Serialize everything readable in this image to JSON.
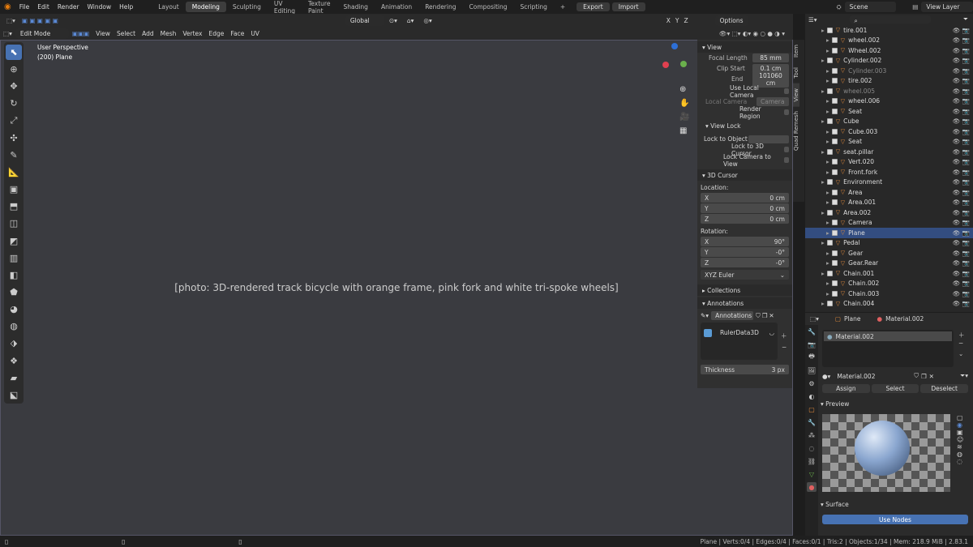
{
  "menu": [
    "File",
    "Edit",
    "Render",
    "Window",
    "Help"
  ],
  "workspaces": [
    "Layout",
    "Modeling",
    "Sculpting",
    "UV Editing",
    "Texture Paint",
    "Shading",
    "Animation",
    "Rendering",
    "Compositing",
    "Scripting"
  ],
  "active_workspace": "Modeling",
  "plus": "+",
  "export_label": "Export",
  "import_label": "Import",
  "scene": "Scene",
  "view_layer": "View Layer",
  "header": {
    "transform": "Global",
    "options": "Options",
    "xyz": [
      "X",
      "Y",
      "Z"
    ]
  },
  "header2": {
    "mode": "Edit Mode",
    "menus": [
      "View",
      "Select",
      "Add",
      "Mesh",
      "Vertex",
      "Edge",
      "Face",
      "UV"
    ]
  },
  "viewport": {
    "line1": "User Perspective",
    "line2": "(200) Plane",
    "photo_label": "[photo: 3D-rendered track bicycle with orange frame, pink fork and white tri-spoke wheels]"
  },
  "npanel": {
    "view_title": "View",
    "focal_length_label": "Focal Length",
    "focal_length": "85 mm",
    "clip_start_label": "Clip Start",
    "clip_start": "0.1 cm",
    "end_label": "End",
    "end": "101060 cm",
    "use_local_camera": "Use Local Camera",
    "local_camera_label": "Local Camera",
    "local_camera": "Camera",
    "render_region": "Render Region",
    "view_lock_title": "View Lock",
    "lock_to_object": "Lock to Object",
    "lock_3d_cursor": "Lock to 3D Cursor",
    "lock_camera_to_view": "Lock Camera to View",
    "cursor_title": "3D Cursor",
    "location_label": "Location:",
    "loc": [
      {
        "axis": "X",
        "value": "0 cm"
      },
      {
        "axis": "Y",
        "value": "0 cm"
      },
      {
        "axis": "Z",
        "value": "0 cm"
      }
    ],
    "rotation_label": "Rotation:",
    "rot": [
      {
        "axis": "X",
        "value": "90°"
      },
      {
        "axis": "Y",
        "value": "-0°"
      },
      {
        "axis": "Z",
        "value": "-0°"
      }
    ],
    "rot_mode": "XYZ Euler",
    "collections": "Collections",
    "annotations_title": "Annotations",
    "annotations_field": "Annotations",
    "ruler": "RulerData3D",
    "thickness_label": "Thickness",
    "thickness": "3 px"
  },
  "ntabs": [
    "Item",
    "Tool",
    "View",
    "Quad Remesh"
  ],
  "outliner": [
    {
      "name": "tire.001",
      "dim": false,
      "sel": false
    },
    {
      "name": "wheel.002",
      "dim": false,
      "sel": false
    },
    {
      "name": "Wheel.002",
      "dim": false,
      "sel": false
    },
    {
      "name": "Cylinder.002",
      "dim": false,
      "sel": false
    },
    {
      "name": "Cylinder.003",
      "dim": true,
      "sel": false
    },
    {
      "name": "tire.002",
      "dim": false,
      "sel": false
    },
    {
      "name": "wheel.005",
      "dim": true,
      "sel": false
    },
    {
      "name": "wheel.006",
      "dim": false,
      "sel": false
    },
    {
      "name": "Seat",
      "dim": false,
      "sel": false
    },
    {
      "name": "Cube",
      "dim": false,
      "sel": false
    },
    {
      "name": "Cube.003",
      "dim": false,
      "sel": false
    },
    {
      "name": "Seat",
      "dim": false,
      "sel": false
    },
    {
      "name": "seat.pillar",
      "dim": false,
      "sel": false
    },
    {
      "name": "Vert.020",
      "dim": false,
      "sel": false
    },
    {
      "name": "Front.fork",
      "dim": false,
      "sel": false
    },
    {
      "name": "Environment",
      "dim": false,
      "sel": false
    },
    {
      "name": "Area",
      "dim": false,
      "sel": false
    },
    {
      "name": "Area.001",
      "dim": false,
      "sel": false
    },
    {
      "name": "Area.002",
      "dim": false,
      "sel": false
    },
    {
      "name": "Camera",
      "dim": false,
      "sel": false
    },
    {
      "name": "Plane",
      "dim": false,
      "sel": true
    },
    {
      "name": "Pedal",
      "dim": false,
      "sel": false
    },
    {
      "name": "Gear",
      "dim": false,
      "sel": false
    },
    {
      "name": "Gear.Rear",
      "dim": false,
      "sel": false
    },
    {
      "name": "Chain.001",
      "dim": false,
      "sel": false
    },
    {
      "name": "Chain.002",
      "dim": false,
      "sel": false
    },
    {
      "name": "Chain.003",
      "dim": false,
      "sel": false
    },
    {
      "name": "Chain.004",
      "dim": false,
      "sel": false
    }
  ],
  "props": {
    "object": "Plane",
    "material_tab": "Material.002",
    "slot": "Material.002",
    "material_name": "Material.002",
    "assign": "Assign",
    "select": "Select",
    "deselect": "Deselect",
    "preview": "Preview",
    "surface": "Surface",
    "use_nodes": "Use Nodes"
  },
  "status": "Plane | Verts:0/4 | Edges:0/4 | Faces:0/1 | Tris:2 | Objects:1/34 | Mem: 218.9 MiB | 2.83.1"
}
